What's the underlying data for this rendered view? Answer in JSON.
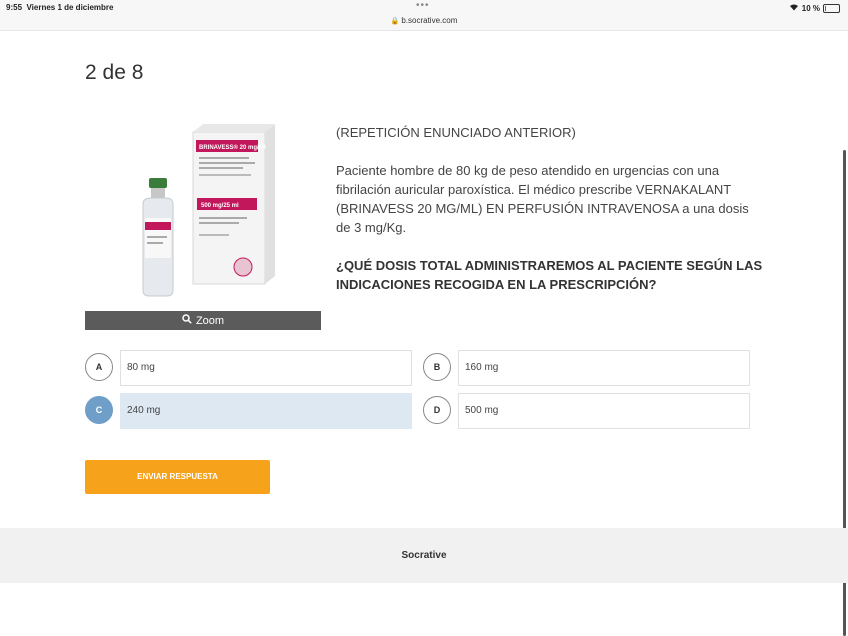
{
  "status_bar": {
    "time": "9:55",
    "date": "Viernes 1 de diciembre",
    "url": "b.socrative.com",
    "battery": "10 %",
    "battery_level": 0.1
  },
  "question": {
    "counter": "2 de 8",
    "zoom_label": "Zoom",
    "repeat_label": "(REPETICIÓN ENUNCIADO ANTERIOR)",
    "case_text": "Paciente hombre de 80 kg de  peso atendido en urgencias con una fibrilación auricular paroxística. El médico prescribe VERNAKALANT (BRINAVESS 20 MG/ML) EN PERFUSIÓN INTRAVENOSA a una dosis de 3 mg/Kg.",
    "ask_text": "¿QUÉ DOSIS TOTAL ADMINISTRAREMOS AL PACIENTE SEGÚN LAS INDICACIONES RECOGIDA EN LA PRESCRIPCIÓN?",
    "image": {
      "brand": "BRINAVESS® 20 mg/ml",
      "dose_label": "500 mg/25 ml"
    }
  },
  "options": [
    {
      "letter": "A",
      "text": "80 mg",
      "selected": false
    },
    {
      "letter": "B",
      "text": "160 mg",
      "selected": false
    },
    {
      "letter": "C",
      "text": "240 mg",
      "selected": true
    },
    {
      "letter": "D",
      "text": "500 mg",
      "selected": false
    }
  ],
  "submit_label": "ENVIAR RESPUESTA",
  "footer": {
    "brand": "Socrative"
  },
  "colors": {
    "accent": "#f7a21b",
    "selected": "#6f9fc9",
    "selected_bg": "#dde8f3"
  }
}
